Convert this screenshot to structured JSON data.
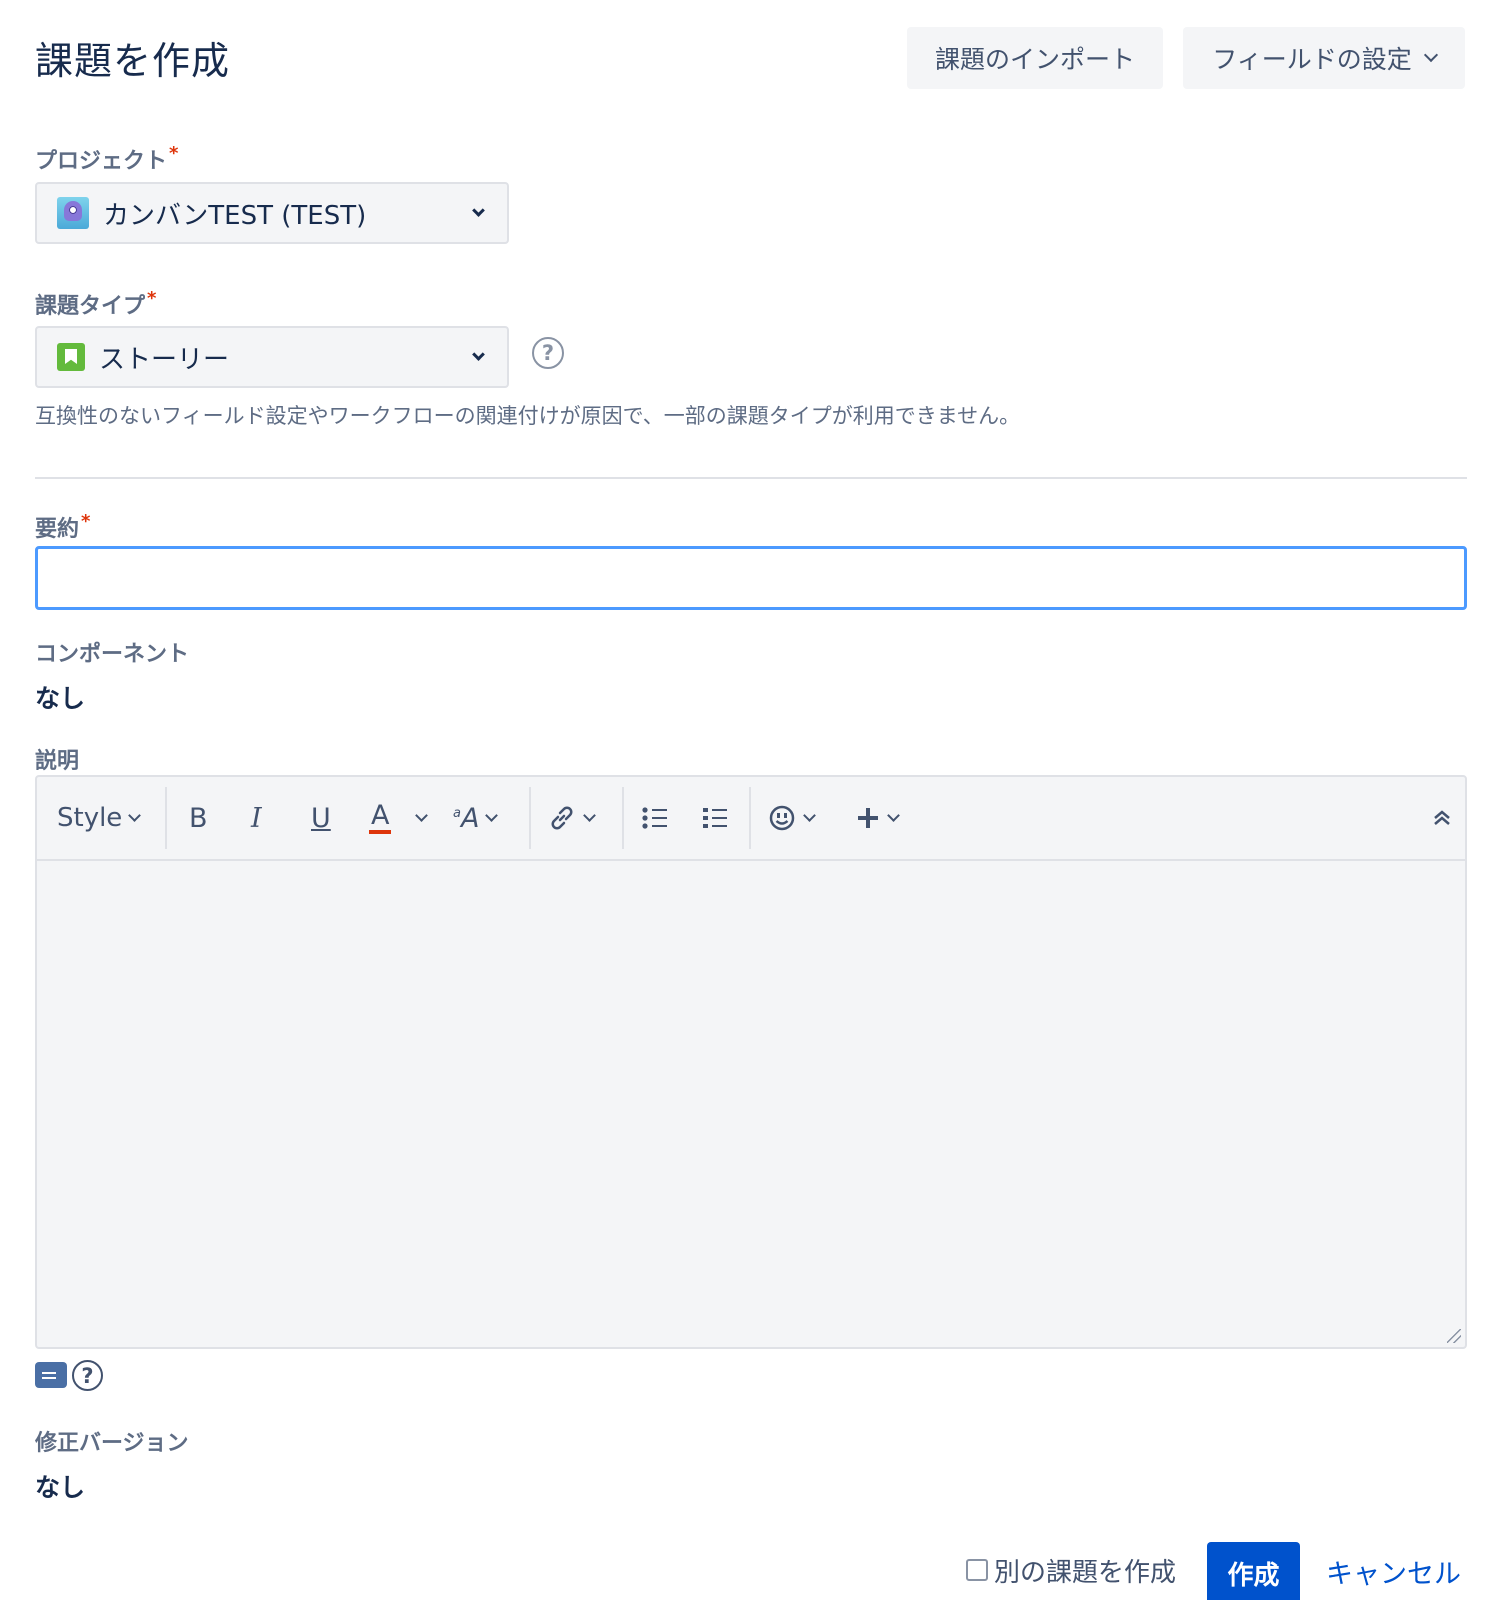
{
  "dialog": {
    "title": "課題を作成"
  },
  "header": {
    "import_label": "課題のインポート",
    "configure_fields_label": "フィールドの設定"
  },
  "required_marker": "*",
  "help_glyph": "?",
  "project": {
    "label": "プロジェクト",
    "value": "カンバンTEST (TEST)",
    "icon": "project-avatar-icon"
  },
  "issue_type": {
    "label": "課題タイプ",
    "value": "ストーリー",
    "icon": "story-icon",
    "note": "互換性のないフィールド設定やワークフローの関連付けが原因で、一部の課題タイプが利用できません。"
  },
  "summary": {
    "label": "要約",
    "value": ""
  },
  "components": {
    "label": "コンポーネント",
    "value": "なし"
  },
  "description": {
    "label": "説明",
    "toolbar": {
      "style_label": "Style",
      "bold": "B",
      "italic": "I",
      "underline": "U",
      "text_color": "A",
      "text_size_sup": "a",
      "text_size": "A"
    }
  },
  "fix_version": {
    "label": "修正バージョン",
    "value": "なし"
  },
  "footer": {
    "create_another_label": "別の課題を作成",
    "create_another_checked": false,
    "create_label": "作成",
    "cancel_label": "キャンセル"
  },
  "colors": {
    "primary": "#0052cc",
    "focus_border": "#4c9aff",
    "required": "#de350b",
    "text_color_underline": "#de350b"
  }
}
